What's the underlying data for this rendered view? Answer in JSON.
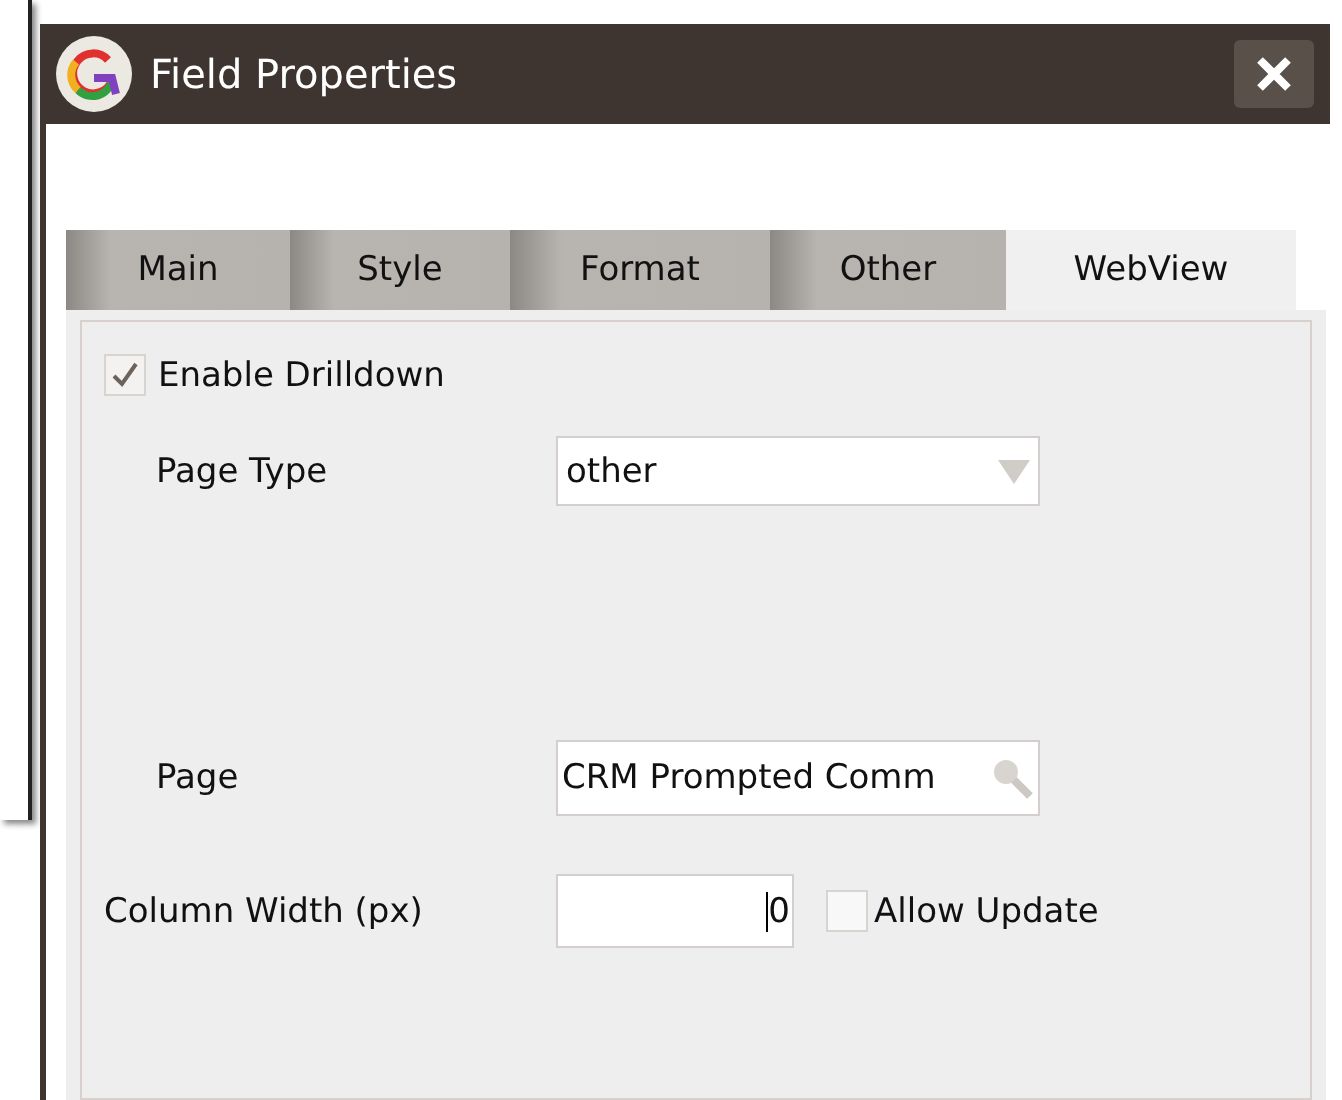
{
  "window": {
    "title": "Field Properties"
  },
  "tabs": [
    {
      "label": "Main",
      "selected": false
    },
    {
      "label": "Style",
      "selected": false
    },
    {
      "label": "Format",
      "selected": false
    },
    {
      "label": "Other",
      "selected": false
    },
    {
      "label": "WebView",
      "selected": true
    }
  ],
  "enable_drilldown": {
    "label": "Enable Drilldown",
    "checked": true
  },
  "page_type": {
    "label": "Page Type",
    "value": "other"
  },
  "page": {
    "label": "Page",
    "value": "CRM Prompted Comm"
  },
  "column_width": {
    "label": "Column Width (px)",
    "value": "0"
  },
  "allow_update": {
    "label": "Allow Update",
    "checked": false
  }
}
